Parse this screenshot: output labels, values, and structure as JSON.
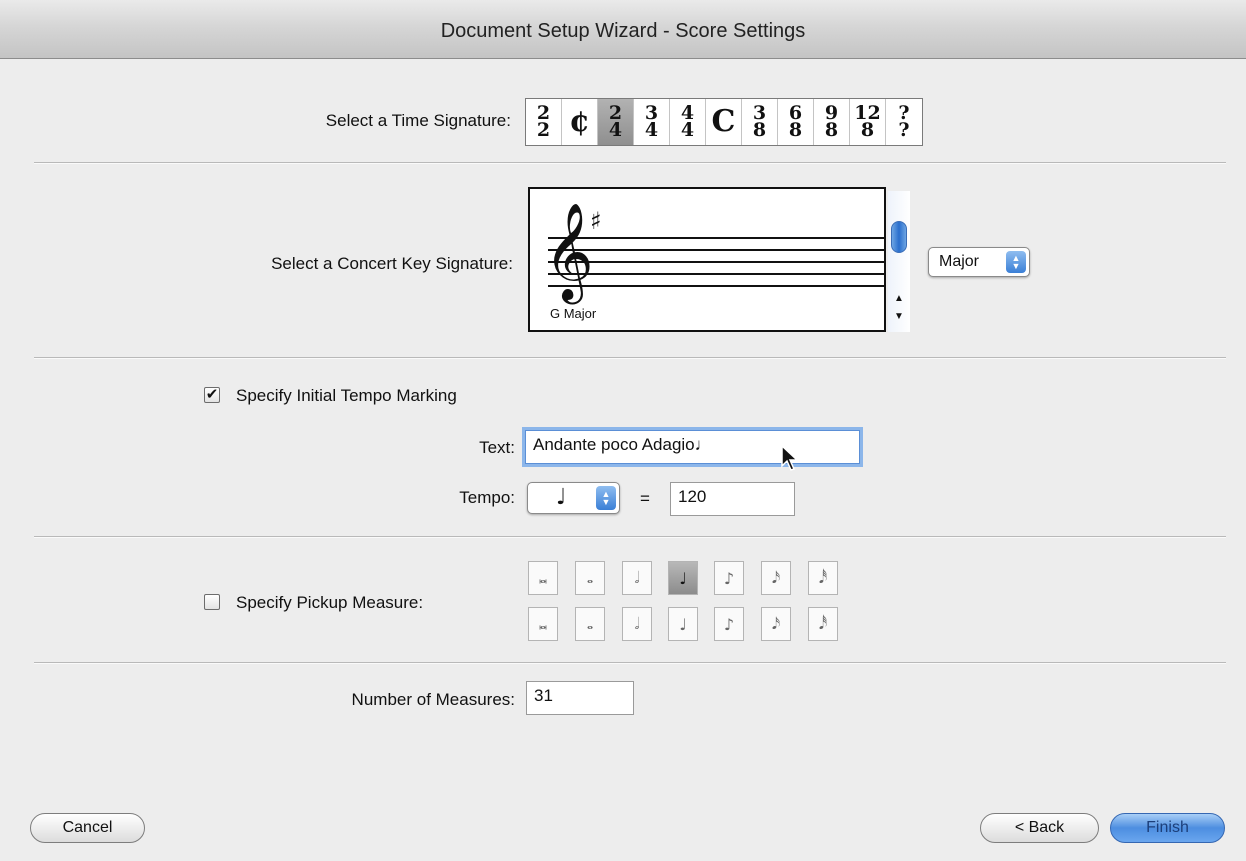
{
  "window": {
    "title": "Document Setup Wizard - Score Settings"
  },
  "time_signature": {
    "label": "Select a Time Signature:",
    "options": [
      {
        "top": "2",
        "bottom": "2"
      },
      {
        "single": "¢"
      },
      {
        "top": "2",
        "bottom": "4"
      },
      {
        "top": "3",
        "bottom": "4"
      },
      {
        "top": "4",
        "bottom": "4"
      },
      {
        "single": "C"
      },
      {
        "top": "3",
        "bottom": "8"
      },
      {
        "top": "6",
        "bottom": "8"
      },
      {
        "top": "9",
        "bottom": "8"
      },
      {
        "top": "12",
        "bottom": "8"
      },
      {
        "top": "?",
        "bottom": "?"
      }
    ],
    "selected_index": 2
  },
  "key_signature": {
    "label": "Select a Concert Key Signature:",
    "key_name": "G Major",
    "clef_glyph": "𝄞",
    "sharp_glyph": "♯",
    "mode_value": "Major"
  },
  "tempo": {
    "checkbox_label": "Specify Initial Tempo Marking",
    "checked": true,
    "text_label": "Text:",
    "text_value": "Andante poco Adagio♩",
    "tempo_label": "Tempo:",
    "note_glyph": "♩",
    "equals": "=",
    "bpm_value": "120"
  },
  "pickup": {
    "checkbox_label": "Specify Pickup Measure:",
    "checked": false,
    "row1": [
      "𝅜",
      "𝅝",
      "𝅗𝅥",
      "♩",
      "♪",
      "𝅘𝅥𝅯",
      "𝅘𝅥𝅰"
    ],
    "row2": [
      "𝅜",
      "𝅝",
      "𝅗𝅥",
      "♩",
      "♪",
      "𝅘𝅥𝅯",
      "𝅘𝅥𝅰"
    ],
    "selected": "row1-3"
  },
  "measures": {
    "label": "Number of Measures:",
    "value": "31"
  },
  "buttons": {
    "cancel": "Cancel",
    "back": "< Back",
    "finish": "Finish"
  }
}
